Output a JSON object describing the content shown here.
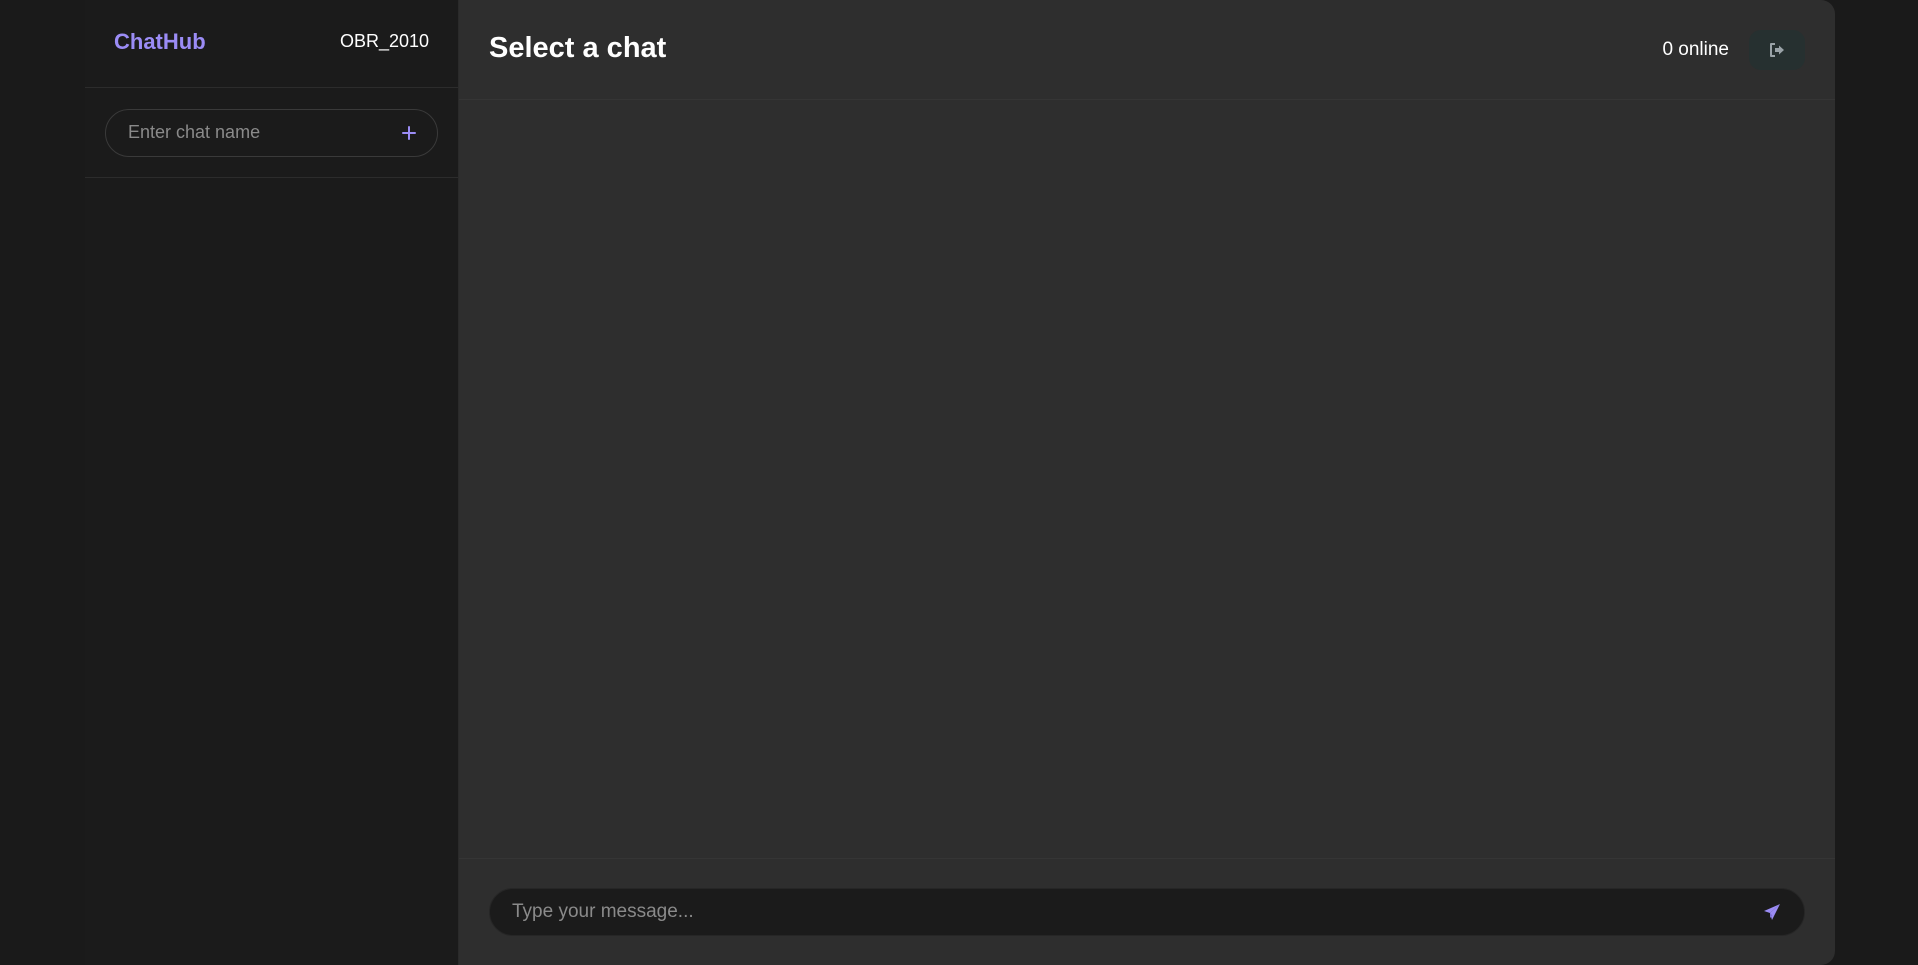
{
  "app": {
    "brand": "ChatHub",
    "username": "OBR_2010"
  },
  "sidebar": {
    "new_chat": {
      "placeholder": "Enter chat name",
      "value": "",
      "add_icon": "plus-icon"
    },
    "chats": []
  },
  "main": {
    "title": "Select a chat",
    "online_count": "0 online",
    "logout_icon": "logout-icon"
  },
  "composer": {
    "placeholder": "Type your message...",
    "value": "",
    "send_icon": "send-icon"
  },
  "colors": {
    "accent": "#9b8cf5",
    "page_bg": "#1a1a1a",
    "sidebar_bg": "#1b1b1b",
    "main_bg": "#2e2e2e"
  }
}
